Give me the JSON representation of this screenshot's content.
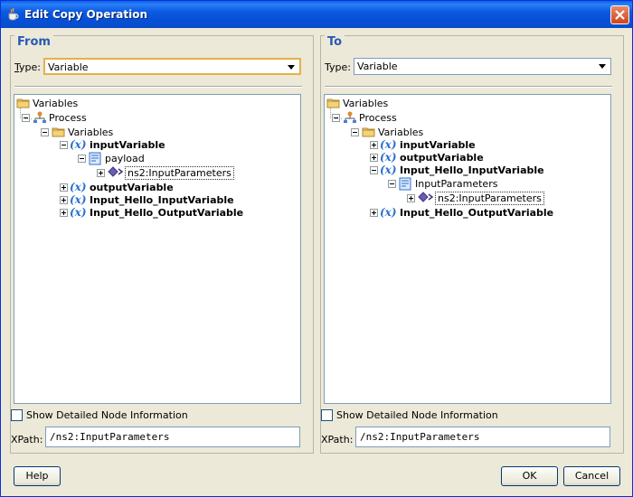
{
  "window": {
    "title": "Edit Copy Operation"
  },
  "from": {
    "title": "From",
    "type_label": "Type:",
    "type_value": "Variable",
    "tree": [
      {
        "label": "Variables",
        "icon": "folder-icon",
        "bold": false
      },
      {
        "label": "Process",
        "icon": "process-icon",
        "bold": false
      },
      {
        "label": "Variables",
        "icon": "folder-icon",
        "bold": false
      },
      {
        "label": "inputVariable",
        "icon": "variable-icon",
        "bold": true
      },
      {
        "label": "payload",
        "icon": "message-part-icon",
        "bold": false
      },
      {
        "label": "ns2:InputParameters",
        "icon": "element-icon",
        "bold": false,
        "selected": true
      },
      {
        "label": "outputVariable",
        "icon": "variable-icon",
        "bold": true
      },
      {
        "label": "Input_Hello_InputVariable",
        "icon": "variable-icon",
        "bold": true
      },
      {
        "label": "Input_Hello_OutputVariable",
        "icon": "variable-icon",
        "bold": true
      }
    ],
    "show_detail_label": "Show Detailed Node Information",
    "show_detail_checked": false,
    "xpath_label": "XPath:",
    "xpath_value": "/ns2:InputParameters"
  },
  "to": {
    "title": "To",
    "type_label": "Type:",
    "type_value": "Variable",
    "tree": [
      {
        "label": "Variables",
        "icon": "folder-icon",
        "bold": false
      },
      {
        "label": "Process",
        "icon": "process-icon",
        "bold": false
      },
      {
        "label": "Variables",
        "icon": "folder-icon",
        "bold": false
      },
      {
        "label": "inputVariable",
        "icon": "variable-icon",
        "bold": true
      },
      {
        "label": "outputVariable",
        "icon": "variable-icon",
        "bold": true
      },
      {
        "label": "Input_Hello_InputVariable",
        "icon": "variable-icon",
        "bold": true
      },
      {
        "label": "InputParameters",
        "icon": "message-part-icon",
        "bold": false
      },
      {
        "label": "ns2:InputParameters",
        "icon": "element-icon",
        "bold": false,
        "selected": true
      },
      {
        "label": "Input_Hello_OutputVariable",
        "icon": "variable-icon",
        "bold": true
      }
    ],
    "show_detail_label": "Show Detailed Node Information",
    "show_detail_checked": false,
    "xpath_label": "XPath:",
    "xpath_value": "/ns2:InputParameters"
  },
  "buttons": {
    "help": "Help",
    "ok": "OK",
    "cancel": "Cancel"
  },
  "colors": {
    "panel_title": "#2859b5",
    "titlebar": "#0a5fe8",
    "window_bg": "#ece9d8"
  }
}
